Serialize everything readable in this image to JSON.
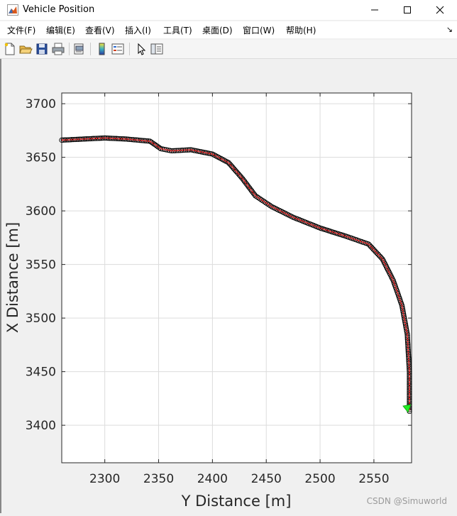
{
  "window": {
    "title": "Vehicle Position",
    "minimize_glyph": "—",
    "maximize_glyph": "☐",
    "close_glyph": "✕"
  },
  "menu": {
    "items": [
      "文件(F)",
      "编辑(E)",
      "查看(V)",
      "插入(I)",
      "工具(T)",
      "桌面(D)",
      "窗口(W)",
      "帮助(H)"
    ],
    "overflow_glyph": "↘"
  },
  "toolbar": {
    "icons": [
      "new-figure-icon",
      "open-file-icon",
      "save-icon",
      "print-icon",
      "print-preview-icon",
      "colorbar-icon",
      "legend-icon",
      "pointer-icon",
      "property-inspector-icon"
    ]
  },
  "chart_data": {
    "type": "scatter",
    "xlabel": "Y Distance [m]",
    "ylabel": "X Distance [m]",
    "xlim": [
      2260,
      2585
    ],
    "ylim": [
      3365,
      3710
    ],
    "xticks": [
      2300,
      2350,
      2400,
      2450,
      2500,
      2550
    ],
    "yticks": [
      3400,
      3450,
      3500,
      3550,
      3600,
      3650,
      3700
    ],
    "grid": true,
    "series": [
      {
        "marker": "circle",
        "color": "#000000",
        "x": [
          2260,
          2280,
          2300,
          2320,
          2342,
          2352,
          2362,
          2380,
          2400,
          2415,
          2428,
          2440,
          2455,
          2475,
          2500,
          2525,
          2545,
          2558,
          2568,
          2576,
          2581,
          2583,
          2583,
          2583
        ],
        "y": [
          3666,
          3667,
          3668,
          3667,
          3665,
          3658,
          3656,
          3657,
          3653,
          3645,
          3630,
          3614,
          3604,
          3594,
          3584,
          3576,
          3569,
          3555,
          3535,
          3512,
          3485,
          3450,
          3430,
          3413
        ]
      },
      {
        "marker": "line",
        "color": "#ff2a2a",
        "x": [
          2260,
          2280,
          2300,
          2320,
          2342,
          2352,
          2362,
          2380,
          2400,
          2415,
          2428,
          2440,
          2455,
          2475,
          2500,
          2525,
          2545,
          2558,
          2568,
          2576,
          2581,
          2583,
          2583,
          2583
        ],
        "y": [
          3666,
          3667,
          3668,
          3667,
          3665,
          3658,
          3656,
          3657,
          3653,
          3645,
          3630,
          3614,
          3604,
          3594,
          3584,
          3576,
          3569,
          3555,
          3535,
          3512,
          3485,
          3450,
          3430,
          3413
        ]
      }
    ],
    "end_marker": {
      "x": 2581,
      "y": 3416,
      "color": "#22ee22"
    }
  },
  "watermark": "CSDN @Simuworld"
}
